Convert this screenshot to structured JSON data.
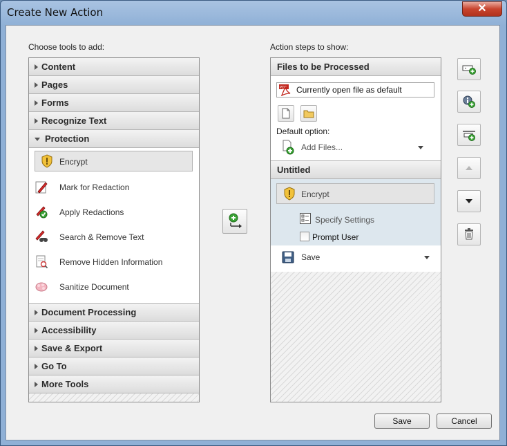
{
  "window": {
    "title": "Create New Action",
    "close_glyph": "✕"
  },
  "left": {
    "heading": "Choose tools to add:",
    "categories_top": [
      "Content",
      "Pages",
      "Forms",
      "Recognize Text"
    ],
    "open_category": "Protection",
    "tools": [
      {
        "label": "Encrypt",
        "icon": "encrypt-shield-icon",
        "selected": true
      },
      {
        "label": "Mark for Redaction",
        "icon": "mark-redaction-icon"
      },
      {
        "label": "Apply Redactions",
        "icon": "apply-redactions-icon"
      },
      {
        "label": "Search & Remove Text",
        "icon": "search-remove-icon"
      },
      {
        "label": "Remove Hidden Information",
        "icon": "remove-hidden-icon"
      },
      {
        "label": "Sanitize Document",
        "icon": "sanitize-icon"
      }
    ],
    "categories_bottom": [
      "Document Processing",
      "Accessibility",
      "Save & Export",
      "Go To",
      "More Tools"
    ]
  },
  "right": {
    "heading": "Action steps to show:",
    "files_header": "Files to be Processed",
    "file_field": "Currently open file as default",
    "default_option_label": "Default option:",
    "add_files_label": "Add Files...",
    "group_header": "Untitled",
    "step_encrypt": "Encrypt",
    "specify_settings": "Specify Settings",
    "prompt_user": "Prompt User",
    "prompt_user_checked": false,
    "save_label": "Save"
  },
  "buttons": {
    "save": "Save",
    "cancel": "Cancel"
  },
  "colors": {
    "accent_green": "#3aa335",
    "selection_blue": "#dde7ee",
    "shield_yellow": "#f2c23a"
  }
}
